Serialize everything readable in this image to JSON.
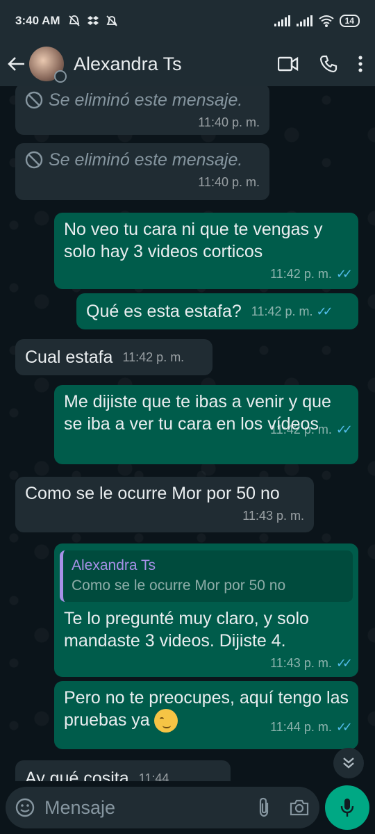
{
  "status_bar": {
    "time": "3:40 AM",
    "battery": "14"
  },
  "header": {
    "contact_name": "Alexandra Ts"
  },
  "messages": [
    {
      "dir": "in",
      "deleted": true,
      "text": "Se eliminó este mensaje.",
      "time": "11:40 p. m."
    },
    {
      "dir": "in",
      "deleted": true,
      "text": "Se eliminó este mensaje.",
      "time": "11:40 p. m."
    },
    {
      "dir": "out",
      "text": "No veo tu cara ni que te vengas y solo hay 3 videos corticos",
      "time": "11:42 p. m."
    },
    {
      "dir": "out",
      "text": "Qué es esta estafa?",
      "time": "11:42 p. m."
    },
    {
      "dir": "in",
      "text": "Cual estafa",
      "time": "11:42 p. m."
    },
    {
      "dir": "out",
      "text": "Me dijiste que te ibas a venir y que se iba a ver tu cara en los vídeos",
      "time": "11:42 p. m."
    },
    {
      "dir": "in",
      "text": "Como se le ocurre Mor por 50 no",
      "time": "11:43 p. m."
    },
    {
      "dir": "out",
      "quote_name": "Alexandra Ts",
      "quote_text": "Como se le ocurre Mor por 50 no",
      "text": "Te lo pregunté muy claro, y solo mandaste 3 videos. Dijiste 4.",
      "time": "11:43 p. m."
    },
    {
      "dir": "out",
      "text": "Pero no te preocupes, aquí tengo las pruebas ya",
      "emoji": "smiling-face",
      "time": "11:44 p. m."
    },
    {
      "dir": "in",
      "text": "Ay qué cosita",
      "time": "11:44"
    }
  ],
  "input": {
    "placeholder": "Mensaje"
  },
  "colors": {
    "incoming": "#202c33",
    "outgoing": "#005c4b",
    "ticks": "#53bdeb",
    "mic": "#00a884"
  }
}
